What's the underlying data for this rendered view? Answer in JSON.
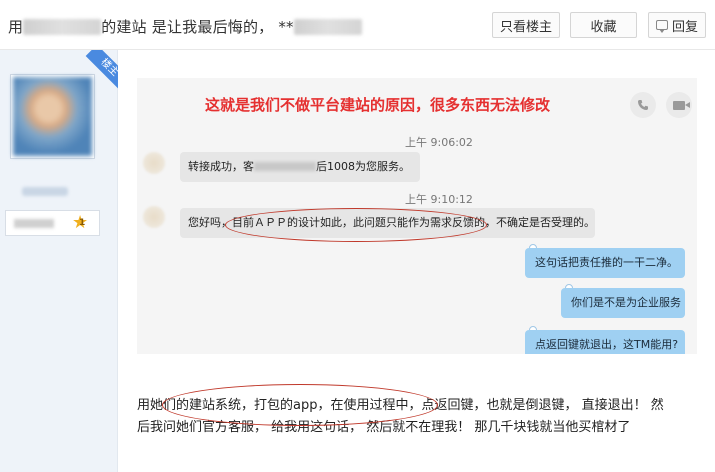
{
  "header": {
    "title_prefix": "用",
    "title_mid": "的建站 是让我最后悔的， **",
    "buttons": {
      "only_op": "只看楼主",
      "favorite": "收藏",
      "reply": "回复"
    }
  },
  "sidebar": {
    "op_badge": "楼主",
    "level": "1"
  },
  "screenshot": {
    "annotation": "这就是我们不做平台建站的原因，很多东西无法修改",
    "messages": [
      {
        "side": "time",
        "text": "上午 9:06:02"
      },
      {
        "side": "left",
        "text_a": "转接成功，客",
        "text_b": "后1008为您服务。"
      },
      {
        "side": "time",
        "text": "上午 9:10:12"
      },
      {
        "side": "left",
        "text": "您好吗，目前ＡＰＰ的设计如此，此问题只能作为需求反馈的，不确定是否受理的。"
      },
      {
        "side": "right",
        "text": "这句话把责任推的一干二净。"
      },
      {
        "side": "right",
        "text": "你们是不是为企业服务"
      },
      {
        "side": "right",
        "text": "点返回键就退出，这TM能用?"
      }
    ]
  },
  "post": {
    "body_line1": "用她们的建站系统，打包的app，在使用过程中，点返回键，也就是倒退键， 直接退出！ 然",
    "body_line2": "后我问她们官方客服， 给我用这句话， 然后就不在理我！ 那几千块钱就当他买棺材了"
  },
  "icons": {
    "phone": "phone-icon",
    "video": "video-icon",
    "reply": "speech-bubble-icon",
    "level": "star-icon"
  },
  "colors": {
    "annotation_red": "#e53030",
    "right_bubble": "#9fd0f2",
    "left_bubble": "#e6e6e6",
    "op_badge": "#4a8ae0",
    "circle_marker": "#c0392b"
  }
}
